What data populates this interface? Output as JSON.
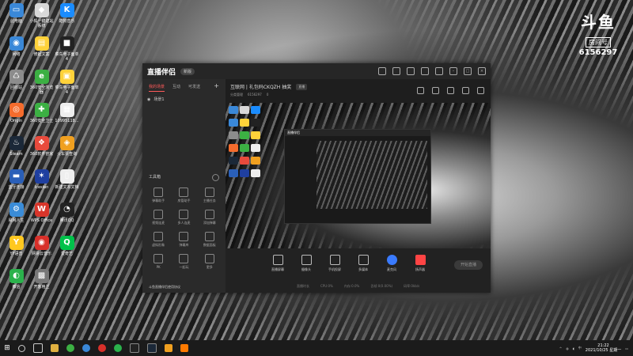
{
  "desktop": {
    "icons": [
      {
        "label": "此电脑",
        "glyph": "▭",
        "color": "#3a88d8"
      },
      {
        "label": "小狐一键建站系统",
        "glyph": "◆",
        "color": "#d8d8d8"
      },
      {
        "label": "酷狗音乐",
        "glyph": "K",
        "color": "#1a8cff"
      },
      {
        "label": "网络",
        "glyph": "◉",
        "color": "#3a88d8"
      },
      {
        "label": "修起文案",
        "glyph": "▤",
        "color": "#ffd23a"
      },
      {
        "label": "菜鸟电子面单4",
        "glyph": "■",
        "color": "#222"
      },
      {
        "label": "回收站",
        "glyph": "♺",
        "color": "#8c8c8c"
      },
      {
        "label": "360安全浏览器",
        "glyph": "e",
        "color": "#3cb043"
      },
      {
        "label": "菜鸟电子面单4",
        "glyph": "▣",
        "color": "#ffd23a"
      },
      {
        "label": "Origin",
        "glyph": "◎",
        "color": "#f56c2d"
      },
      {
        "label": "360安全卫士",
        "glyph": "✚",
        "color": "#3cb043"
      },
      {
        "label": "10995118...",
        "glyph": "▦",
        "color": "#eee"
      },
      {
        "label": "Steam",
        "glyph": "♨",
        "color": "#1b2838"
      },
      {
        "label": "360软件管家",
        "glyph": "❖",
        "color": "#e84a3c"
      },
      {
        "label": "火车票查询",
        "glyph": "◈",
        "color": "#f0a020"
      },
      {
        "label": "蓝牙连接",
        "glyph": "▬",
        "color": "#2a5fb8"
      },
      {
        "label": "Icesian",
        "glyph": "✶",
        "color": "#1f3fa0"
      },
      {
        "label": "新建文本文档",
        "glyph": "▯",
        "color": "#eee"
      },
      {
        "label": "易网人生",
        "glyph": "⚙",
        "color": "#3a8cd8"
      },
      {
        "label": "WPS Office",
        "glyph": "W",
        "color": "#d8352a"
      },
      {
        "label": "腾讯QQ",
        "glyph": "◔",
        "color": "#222"
      },
      {
        "label": "YY语音",
        "glyph": "Y",
        "color": "#ffc820"
      },
      {
        "label": "网易云音乐",
        "glyph": "◉",
        "color": "#d8302a"
      },
      {
        "label": "爱奇艺",
        "glyph": "Q",
        "color": "#00c24a"
      },
      {
        "label": "微信",
        "glyph": "◐",
        "color": "#2bb24c"
      },
      {
        "label": "开客格兰",
        "glyph": "▩",
        "color": "#777"
      }
    ]
  },
  "watermark": {
    "logo": "斗鱼",
    "room_label": "房间号",
    "room_number": "6156297"
  },
  "app": {
    "brand": "直播伴侣",
    "version": "新版",
    "left_tabs": [
      "我的场景",
      "互动",
      "可发送"
    ],
    "scene_name": "场景1",
    "tools_title": "工具箱",
    "tools": [
      "弹幕助手",
      "房管助手",
      "主播任务",
      "视频连麦",
      "多人连麦",
      "添加弹幕",
      "虚拟形象",
      "弹幕库",
      "数据面板",
      "PK",
      "一起玩",
      "更多"
    ],
    "warning": "斗鱼直播伴侣使用协议",
    "room_title": "互联网 | 礼包码CKQZH 抽奖",
    "room_tag": "直播",
    "room_category": "分类管理",
    "room_id": "6156297",
    "room_likes": "0",
    "controls": [
      "直播屏幕",
      "摄像头",
      "手机投屏",
      "多媒体",
      "麦克风",
      "扬声器"
    ],
    "start_button": "开始直播",
    "stats": [
      "直播时长",
      "CPU:0%",
      "内存:0.0%",
      "丢帧:0(0.00%)",
      "码率:0kb/s"
    ]
  },
  "taskbar": {
    "time": "21:22",
    "date": "2021/10/25 星期一"
  }
}
